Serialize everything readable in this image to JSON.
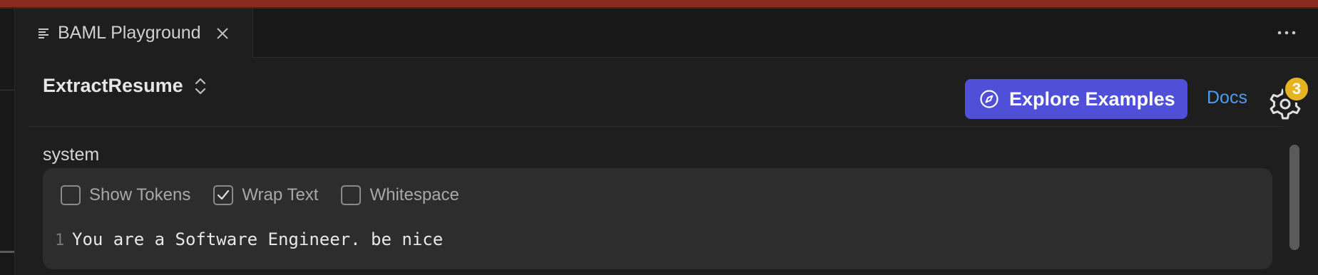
{
  "tab": {
    "title": "BAML Playground"
  },
  "function_selector": {
    "name": "ExtractResume"
  },
  "header": {
    "explore_label": "Explore Examples",
    "docs_label": "Docs",
    "notification_count": "3",
    "accent_color": "#4f4fd8",
    "badge_color": "#e7b421"
  },
  "prompt": {
    "section_label": "system",
    "options": [
      {
        "label": "Show Tokens",
        "checked": false
      },
      {
        "label": "Wrap Text",
        "checked": true
      },
      {
        "label": "Whitespace",
        "checked": false
      }
    ],
    "lines": [
      {
        "number": "1",
        "text": "You are a Software Engineer. be nice"
      }
    ]
  },
  "icons": [
    "file-lines-icon",
    "close-icon",
    "more-icon",
    "chevron-updown-icon",
    "compass-icon",
    "gear-icon",
    "check-icon"
  ]
}
